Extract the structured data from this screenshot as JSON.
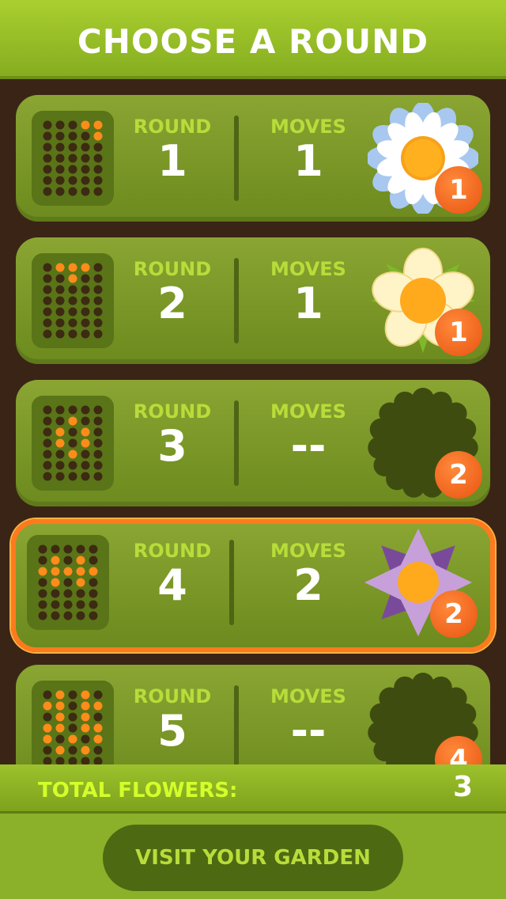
{
  "header": {
    "title": "CHOOSE A ROUND"
  },
  "labels": {
    "round": "ROUND",
    "moves": "MOVES"
  },
  "rounds": [
    {
      "round": "1",
      "moves": "1",
      "badge": "1",
      "flower": "blue-daisy-icon",
      "selected": false,
      "lit": [
        [
          0,
          3
        ],
        [
          0,
          4
        ],
        [
          1,
          4
        ]
      ]
    },
    {
      "round": "2",
      "moves": "1",
      "badge": "1",
      "flower": "cream-flower-icon",
      "selected": false,
      "lit": [
        [
          0,
          1
        ],
        [
          0,
          2
        ],
        [
          0,
          3
        ],
        [
          1,
          2
        ]
      ]
    },
    {
      "round": "3",
      "moves": "--",
      "badge": "2",
      "flower": "locked-flower-silhouette-icon",
      "selected": false,
      "lit": [
        [
          1,
          2
        ],
        [
          2,
          1
        ],
        [
          2,
          3
        ],
        [
          3,
          1
        ],
        [
          3,
          3
        ],
        [
          4,
          2
        ]
      ]
    },
    {
      "round": "4",
      "moves": "2",
      "badge": "2",
      "flower": "purple-lotus-icon",
      "selected": true,
      "lit": [
        [
          1,
          1
        ],
        [
          1,
          3
        ],
        [
          2,
          0
        ],
        [
          2,
          1
        ],
        [
          2,
          2
        ],
        [
          2,
          3
        ],
        [
          2,
          4
        ],
        [
          3,
          1
        ],
        [
          3,
          3
        ]
      ]
    },
    {
      "round": "5",
      "moves": "--",
      "badge": "4",
      "flower": "locked-flower-silhouette-icon",
      "selected": false,
      "lit": [
        [
          0,
          1
        ],
        [
          0,
          3
        ],
        [
          1,
          0
        ],
        [
          1,
          1
        ],
        [
          1,
          3
        ],
        [
          1,
          4
        ],
        [
          2,
          1
        ],
        [
          2,
          3
        ],
        [
          3,
          0
        ],
        [
          3,
          1
        ],
        [
          3,
          3
        ],
        [
          3,
          4
        ],
        [
          4,
          0
        ],
        [
          4,
          2
        ],
        [
          4,
          4
        ],
        [
          5,
          1
        ],
        [
          5,
          3
        ]
      ]
    }
  ],
  "footer": {
    "total_label": "TOTAL FLOWERS:",
    "total_value": "3",
    "garden_button": "VISIT YOUR GARDEN"
  },
  "colors": {
    "accent": "#b8dc3a",
    "selected_border": "#ff7a1e",
    "badge": "#f06a1f",
    "peg_off": "#3d2a12",
    "peg_on": "#ff8c1a"
  }
}
